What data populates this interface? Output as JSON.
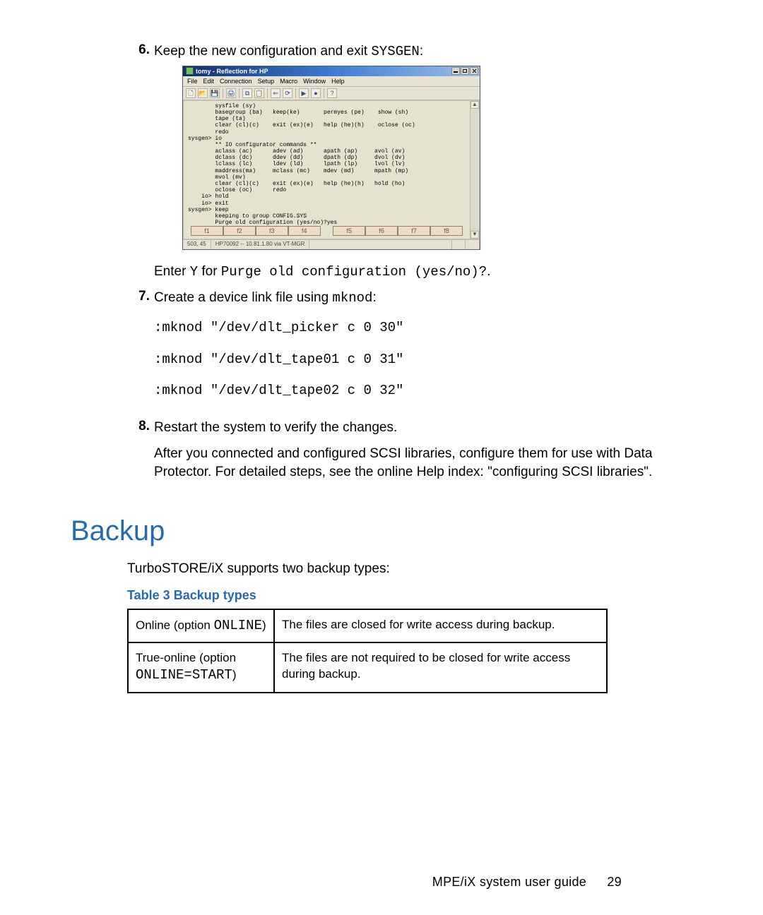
{
  "step6": {
    "num": "6.",
    "text_pre": "Keep the new configuration and exit ",
    "code": "SYSGEN",
    "text_post": ":"
  },
  "win": {
    "title": "tomy - Reflection for HP",
    "menus": [
      "File",
      "Edit",
      "Connection",
      "Setup",
      "Macro",
      "Window",
      "Help"
    ],
    "toolbar_icons": [
      "new-file-icon",
      "open-icon",
      "save-icon",
      "print-icon",
      "copy-icon",
      "paste-icon",
      "back-icon",
      "reload-icon",
      "play-icon",
      "stop-icon",
      "help-icon"
    ],
    "terminal": [
      "        sysfile (sy)",
      "",
      "        basegroup (ba)   keep(ke)       permyes (pe)    show (sh)",
      "        tape (ta)",
      "",
      "        clear (cl)(c)    exit (ex)(e)   help (he)(h)    oclose (oc)",
      "        redo",
      "sysgen> io",
      "",
      "        ** IO configurator commands **",
      "",
      "        aclass (ac)      adev (ad)      apath (ap)     avol (av)",
      "        dclass (dc)      ddev (dd)      dpath (dp)     dvol (dv)",
      "        lclass (lc)      ldev (ld)      lpath (lp)     lvol (lv)",
      "        maddress(ma)     mclass (mc)    mdev (md)      mpath (mp)",
      "        mvol (mv)",
      "",
      "        clear (cl)(c)    exit (ex)(e)   help (he)(h)   hold (ho)",
      "        oclose (oc)      redo",
      "    io> hold",
      "    io> exit",
      "sysgen> keep",
      "        keeping to group CONFIG.SYS",
      "        Purge old configuration (yes/no)?yes"
    ],
    "fkeys": [
      "f1",
      "f2",
      "f3",
      "f4",
      "",
      "f5",
      "f6",
      "f7",
      "f8"
    ],
    "status_a": "503, 45",
    "status_b": "HP70092 -- 10.81.1.80 via VT-MGR"
  },
  "step6b": {
    "pre": "Enter ",
    "code_y": "Y",
    "mid": " for ",
    "code_line": "Purge old configuration (yes/no)?",
    "post": "."
  },
  "step7": {
    "num": "7.",
    "text_pre": "Create a device link file using ",
    "code": "mknod",
    "text_post": ":",
    "cmds": [
      ":mknod \"/dev/dlt_picker c 0 30\"",
      ":mknod \"/dev/dlt_tape01 c 0 31\"",
      ":mknod \"/dev/dlt_tape02 c 0 32\""
    ]
  },
  "step8": {
    "num": "8.",
    "line1": "Restart the system to verify the changes.",
    "line2": "After you connected and configured SCSI libraries, configure them for use with Data Protector. For detailed steps, see the online Help index: \"configuring SCSI libraries\"."
  },
  "section_heading": "Backup",
  "intro": "TurboSTORE/iX supports two backup types:",
  "table_caption": "Table 3 Backup types",
  "table": {
    "r1c1_pre": "Online (option ",
    "r1c1_code": "ONLINE",
    "r1c1_post": ")",
    "r1c2": "The files are closed for write access during backup.",
    "r2c1_pre": "True-online (option ",
    "r2c1_code": "ONLINE=START",
    "r2c1_post": ")",
    "r2c2": "The files are not required to be closed for write access during backup."
  },
  "footer": {
    "label": "MPE/iX system user guide",
    "page": "29"
  }
}
